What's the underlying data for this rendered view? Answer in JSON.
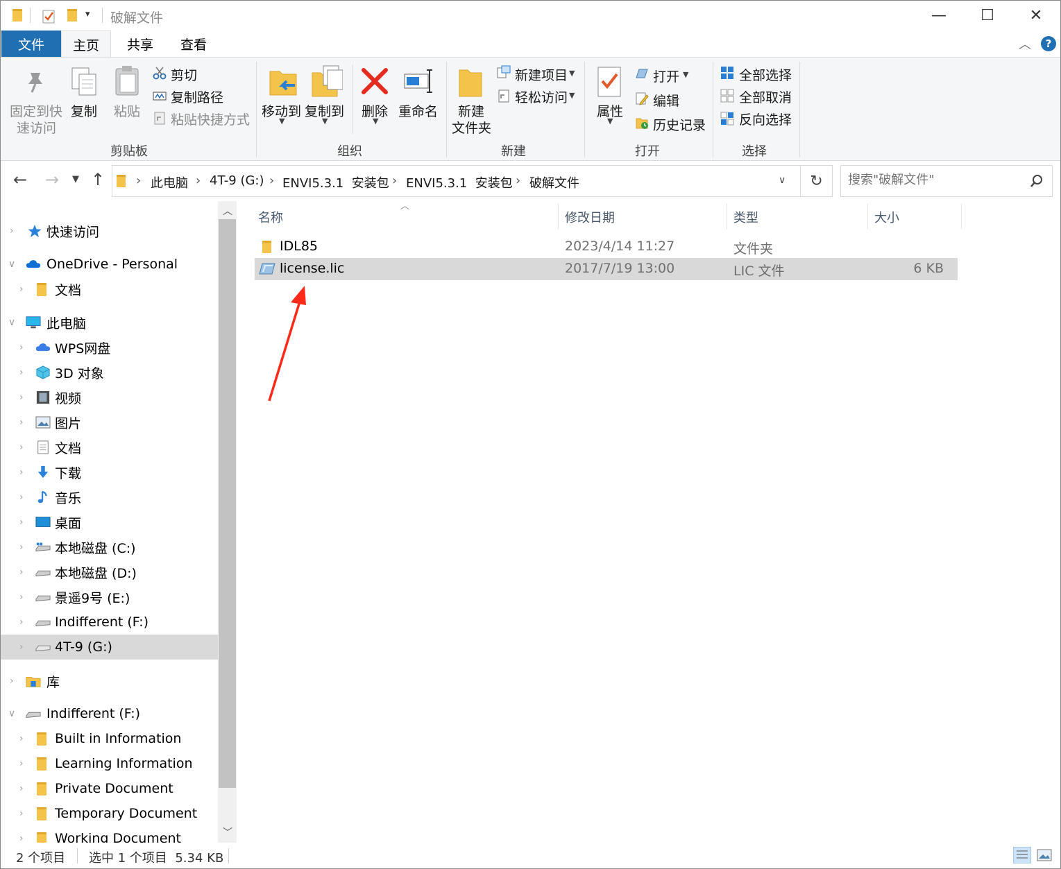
{
  "window": {
    "title": "破解文件",
    "minimize": "—",
    "maximize": "☐",
    "close": "✕"
  },
  "ribbon_tabs": [
    "文件",
    "主页",
    "共享",
    "查看"
  ],
  "ribbon": {
    "clipboard": {
      "pin": "固定到快速访问",
      "pin_line1": "固定到快",
      "pin_line2": "速访问",
      "copy": "复制",
      "paste": "粘贴",
      "cut": "剪切",
      "copy_path": "复制路径",
      "paste_shortcut": "粘贴快捷方式",
      "group": "剪贴板"
    },
    "organize": {
      "move_to": "移动到",
      "copy_to": "复制到",
      "delete": "删除",
      "rename": "重命名",
      "group": "组织"
    },
    "new": {
      "new_folder_line1": "新建",
      "new_folder_line2": "文件夹",
      "new_item": "新建项目",
      "easy_access": "轻松访问",
      "group": "新建"
    },
    "open": {
      "properties": "属性",
      "open": "打开",
      "edit": "编辑",
      "history": "历史记录",
      "group": "打开"
    },
    "select": {
      "select_all": "全部选择",
      "select_none": "全部取消",
      "invert": "反向选择",
      "group": "选择"
    }
  },
  "address": {
    "crumbs": [
      "此电脑",
      "4T-9 (G:)",
      "ENVI5.3.1  安装包",
      "ENVI5.3.1  安装包",
      "破解文件"
    ],
    "search_placeholder": "搜索\"破解文件\""
  },
  "nav_tree": [
    {
      "label": "快速访问",
      "icon": "star-icon",
      "level": 0
    },
    {
      "label": "OneDrive - Personal",
      "icon": "cloud-icon",
      "level": 0
    },
    {
      "label": "文档",
      "icon": "folder-icon",
      "level": 1
    },
    {
      "label": "此电脑",
      "icon": "computer-icon",
      "level": 0
    },
    {
      "label": "WPS网盘",
      "icon": "wps-cloud-icon",
      "level": 1
    },
    {
      "label": "3D 对象",
      "icon": "cube-icon",
      "level": 1
    },
    {
      "label": "视频",
      "icon": "video-icon",
      "level": 1
    },
    {
      "label": "图片",
      "icon": "picture-icon",
      "level": 1
    },
    {
      "label": "文档",
      "icon": "document-icon",
      "level": 1
    },
    {
      "label": "下载",
      "icon": "download-icon",
      "level": 1
    },
    {
      "label": "音乐",
      "icon": "music-icon",
      "level": 1
    },
    {
      "label": "桌面",
      "icon": "desktop-icon",
      "level": 1
    },
    {
      "label": "本地磁盘 (C:)",
      "icon": "drive-icon",
      "level": 1
    },
    {
      "label": "本地磁盘 (D:)",
      "icon": "drive-icon",
      "level": 1
    },
    {
      "label": "景遥9号 (E:)",
      "icon": "drive-icon",
      "level": 1
    },
    {
      "label": "Indifferent (F:)",
      "icon": "drive-icon",
      "level": 1
    },
    {
      "label": "4T-9 (G:)",
      "icon": "drive-icon",
      "level": 1,
      "selected": true
    },
    {
      "label": "库",
      "icon": "library-icon",
      "level": 0
    },
    {
      "label": "Indifferent (F:)",
      "icon": "drive-icon",
      "level": 0
    },
    {
      "label": "Built in Information",
      "icon": "folder-icon",
      "level": 1
    },
    {
      "label": "Learning Information",
      "icon": "folder-icon",
      "level": 1
    },
    {
      "label": "Private Document",
      "icon": "folder-icon",
      "level": 1
    },
    {
      "label": "Temporary Document",
      "icon": "folder-icon",
      "level": 1
    },
    {
      "label": "Working Document",
      "icon": "folder-icon",
      "level": 1
    }
  ],
  "columns": [
    "名称",
    "修改日期",
    "类型",
    "大小"
  ],
  "files": [
    {
      "name": "IDL85",
      "modified": "2023/4/14 11:27",
      "type": "文件夹",
      "size": "",
      "icon": "folder-icon"
    },
    {
      "name": "license.lic",
      "modified": "2017/7/19 13:00",
      "type": "LIC 文件",
      "size": "6 KB",
      "icon": "license-file-icon",
      "selected": true
    }
  ],
  "status": {
    "count": "2 个项目",
    "selection": "选中 1 个项目  5.34 KB"
  },
  "colors": {
    "accent": "#1f6fb2",
    "selection": "#d9d9d9",
    "annotation_arrow": "#ff2a1a"
  }
}
